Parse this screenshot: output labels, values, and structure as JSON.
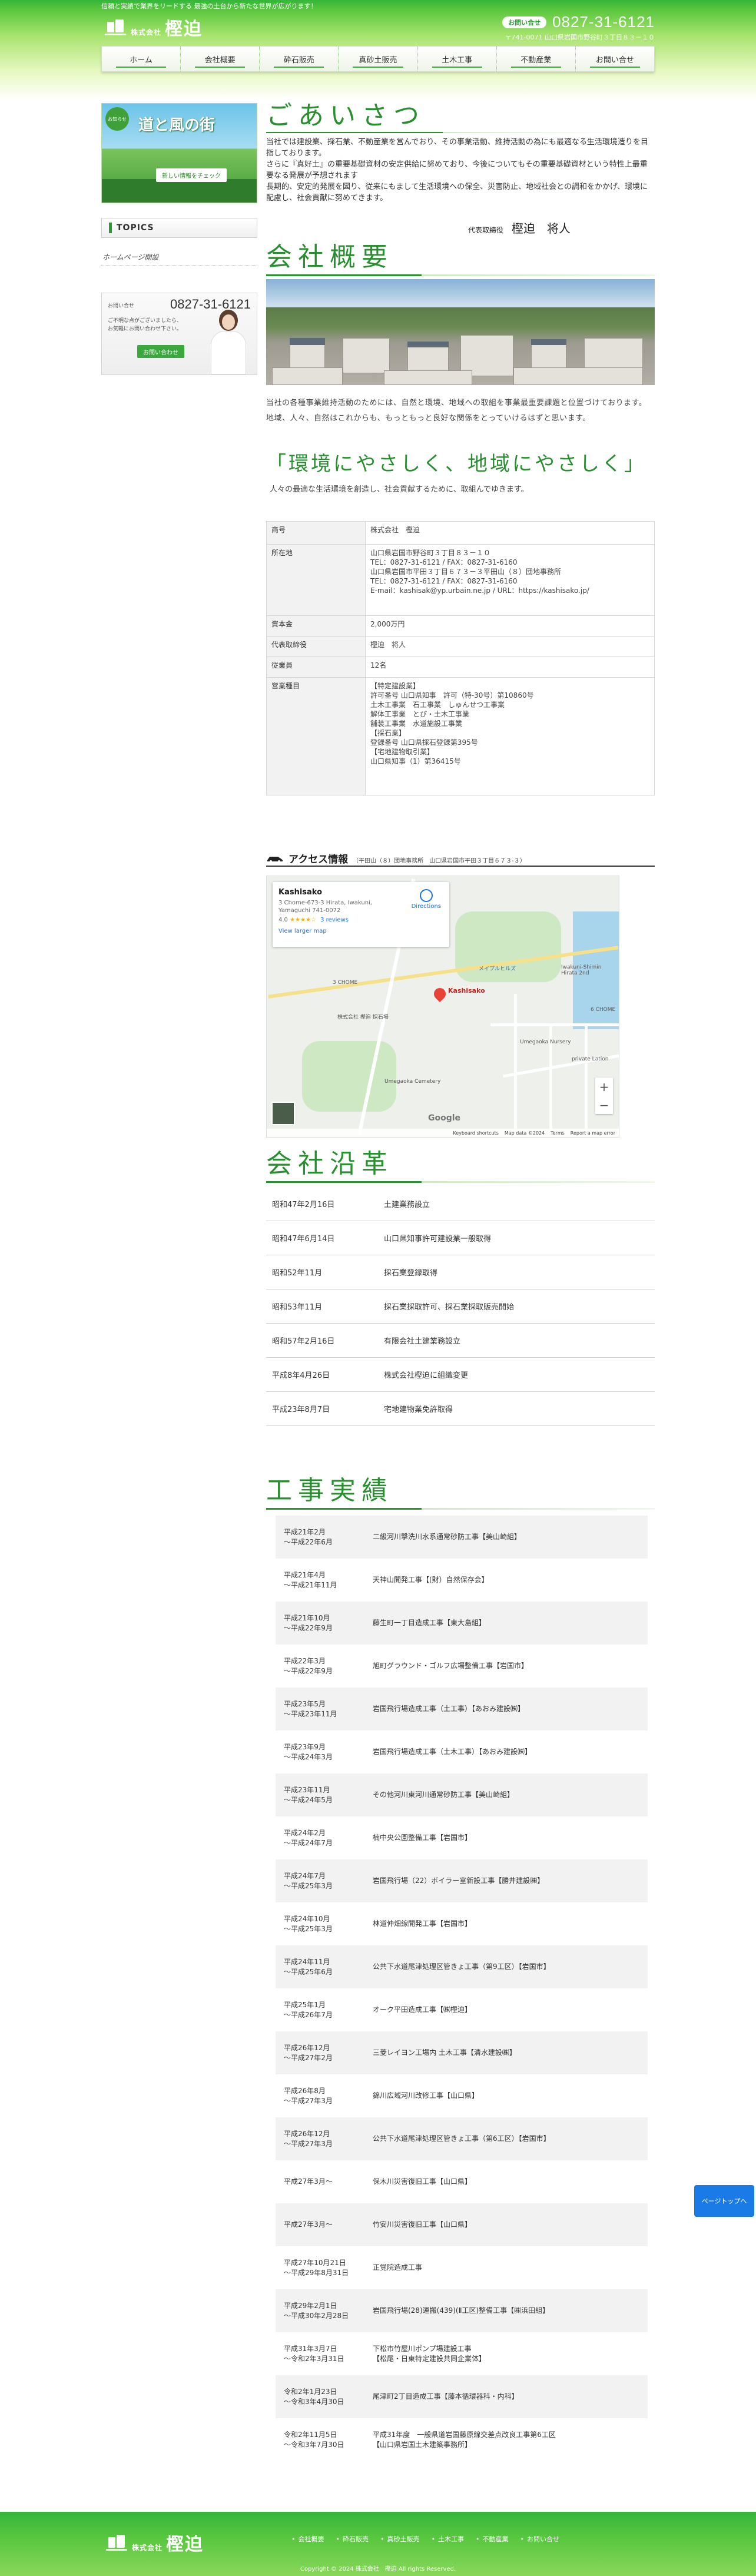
{
  "header": {
    "tagline": "信頼と実績で業界をリードする 最強の土台から新たな世界が広がります！",
    "logo_prefix": "株式会社",
    "logo_name": "樫迫",
    "contact_badge": "お問い合せ",
    "phone": "0827-31-6121",
    "address": "〒741-0071 山口県岩国市野谷町３丁目８３－１０"
  },
  "nav": [
    "ホーム",
    "会社概要",
    "砕石販売",
    "真砂土販売",
    "土木工事",
    "不動産業",
    "お問い合せ"
  ],
  "sidebar": {
    "banner_badge": "お知らせ",
    "banner_title": "道と風の街",
    "banner_sub": "新しい情報をチェック",
    "topics_label": "TOPICS",
    "topics_link": "ホームページ開設",
    "contact_label": "お問い合せ",
    "contact_phone": "0827-31-6121",
    "contact_text": "ご不明な点がございましたら、お気軽にお問い合わせ下さい。",
    "contact_button": "お問い合わせ"
  },
  "greeting": {
    "title": "ごあいさつ",
    "body": "当社では建設業、採石業、不動産業を営んでおり、その事業活動、維持活動の為にも最適なる生活環境造りを目指しております。\nさらに『真好土』の重要基礎資材の安定供給に努めており、今後についてもその重要基礎資材という特性上最重要なる発展が予想されます\n長期的、安定的発展を図り、従来にもまして生活環境への保全、災害防止、地域社会との調和をかかげ、環境に配慮し、社会貢献に努めてきます。",
    "sign_role": "代表取締役",
    "sign_name": "樫迫　将人"
  },
  "overview": {
    "title": "会社概要",
    "text": "当社の各種事業維持活動のためには、自然と環境、地域への取組を事業最重要課題と位置づけております。\n地域、人々、自然はこれからも、もっともっと良好な関係をとっていけるはずと思います。",
    "slogan": "「環境にやさしく、地域にやさしく」",
    "slogan_sub": "人々の最適な生活環境を創造し、社会貢献するために、取組んでゆきます。",
    "table": [
      {
        "k": "商号",
        "v": "株式会社　樫迫"
      },
      {
        "k": "所在地",
        "v": "山口県岩国市野谷町３丁目８３－１０\nTEL：0827-31-6121 / FAX：0827-31-6160\n山口県岩国市平田３丁目６７３－３平田山（８）団地事務所\nTEL：0827-31-6121 / FAX：0827-31-6160\nE-mail：kashisak@yp.urbain.ne.jp / URL：https://kashisako.jp/"
      },
      {
        "k": "資本金",
        "v": "2,000万円"
      },
      {
        "k": "代表取締役",
        "v": "樫迫　将人"
      },
      {
        "k": "従業員",
        "v": "12名"
      },
      {
        "k": "営業種目",
        "v": "【特定建設業】\n許可番号 山口県知事　許可（特-30号）第10860号\n土木工事業　石工事業　しゅんせつ工事業\n解体工事業　とび・土木工事業\n舗装工事業　水道施設工事業\n【採石業】\n登録番号 山口県採石登録第395号\n【宅地建物取引業】\n山口県知事（1）第36415号"
      }
    ]
  },
  "access": {
    "label": "アクセス情報",
    "addr": "（平田山（８）団地事務所　山口県岩国市平田３丁目６７３-３）",
    "map_name": "Kashisako",
    "map_addr": "3 Chome-673-3 Hirata, Iwakuni, Yamaguchi 741-0072",
    "map_rating": "4.0",
    "map_stars": "★★★★☆",
    "map_reviews": "3 reviews",
    "map_larger": "View larger map",
    "map_directions": "Directions",
    "pin_label": "Kashisako",
    "map_label_1": "メイプルヒルズ",
    "map_label_2": "Iwakuni-Shimin Hirata 2nd",
    "map_label_3": "3 CHOME",
    "map_label_4": "Umegaoka Nursery",
    "map_label_5": "Umegaoka Cemetery",
    "map_label_6": "private Lation",
    "map_label_7": "6 CHOME",
    "map_label_8": "株式会社 樫迫 採石場",
    "google": "Google",
    "map_footer": [
      "Keyboard shortcuts",
      "Map data ©2024",
      "Terms",
      "Report a map error"
    ]
  },
  "history": {
    "title": "会社沿革",
    "rows": [
      {
        "d": "昭和47年2月16日",
        "t": "土建業務設立"
      },
      {
        "d": "昭和47年6月14日",
        "t": "山口県知事許可建設業一般取得"
      },
      {
        "d": "昭和52年11月",
        "t": "採石業登録取得"
      },
      {
        "d": "昭和53年11月",
        "t": "採石業採取許可、採石業採取販売開始"
      },
      {
        "d": "昭和57年2月16日",
        "t": "有限会社土建業務設立"
      },
      {
        "d": "平成8年4月26日",
        "t": "株式会社樫迫に組織変更"
      },
      {
        "d": "平成23年8月7日",
        "t": "宅地建物業免許取得"
      }
    ]
  },
  "works": {
    "title": "工事実績",
    "rows": [
      {
        "d": "平成21年2月\n〜平成22年6月",
        "t": "二級河川撃洗川水系通常砂防工事【美山崎組】"
      },
      {
        "d": "平成21年4月\n〜平成21年11月",
        "t": "天神山開発工事【(財）自然保存会】"
      },
      {
        "d": "平成21年10月\n〜平成22年9月",
        "t": "藤生町一丁目造成工事【東大島組】"
      },
      {
        "d": "平成22年3月\n〜平成22年9月",
        "t": "旭町グラウンド・ゴルフ広場整備工事【岩国市】"
      },
      {
        "d": "平成23年5月\n〜平成23年11月",
        "t": "岩国飛行場造成工事（土工事）【あおみ建設㈱】"
      },
      {
        "d": "平成23年9月\n〜平成24年3月",
        "t": "岩国飛行場造成工事（土木工事）【あおみ建設㈱】"
      },
      {
        "d": "平成23年11月\n〜平成24年5月",
        "t": "その他河川東河川通常砂防工事【美山崎組】"
      },
      {
        "d": "平成24年2月\n〜平成24年7月",
        "t": "楠中央公園整備工事【岩国市】"
      },
      {
        "d": "平成24年7月\n〜平成25年3月",
        "t": "岩国飛行場（22）ボイラー室新設工事【勝井建設㈱】"
      },
      {
        "d": "平成24年10月\n〜平成25年3月",
        "t": "林道仲畑線開発工事【岩国市】"
      },
      {
        "d": "平成24年11月\n〜平成25年6月",
        "t": "公共下水道尾津処理区管きょ工事（第9工区）【岩国市】"
      },
      {
        "d": "平成25年1月\n〜平成26年7月",
        "t": "オーク平田造成工事【㈱樫迫】"
      },
      {
        "d": "平成26年12月\n〜平成27年2月",
        "t": "三菱レイヨン工場内 土木工事【清水建設㈱】"
      },
      {
        "d": "平成26年8月\n〜平成27年3月",
        "t": "錦川広域河川改修工事【山口県】"
      },
      {
        "d": "平成26年12月\n〜平成27年3月",
        "t": "公共下水道尾津処理区管きょ工事（第6工区）【岩国市】"
      },
      {
        "d": "平成27年3月〜",
        "t": "保木川災害復旧工事【山口県】"
      },
      {
        "d": "平成27年3月〜",
        "t": "竹安川災害復旧工事【山口県】"
      },
      {
        "d": "平成27年10月21日\n〜平成29年8月31日",
        "t": "正覚院造成工事"
      },
      {
        "d": "平成29年2月1日\n〜平成30年2月28日",
        "t": "岩国飛行場(28)運搬(439)(Ⅱ工区)整備工事【㈱浜田組】"
      },
      {
        "d": "平成31年3月7日\n〜令和2年3月31日",
        "t": "下松市竹屋川ポンプ場建設工事\n【松尾・日東特定建設共同企業体】"
      },
      {
        "d": "令和2年1月23日\n〜令和3年4月30日",
        "t": "尾津町2丁目造成工事【藤本循環器科・内科】"
      },
      {
        "d": "令和2年11月5日\n〜令和3年7月30日",
        "t": "平成31年度　一般県道岩国藤原線交差点改良工事第6工区\n【山口県岩国土木建築事務所】"
      }
    ]
  },
  "pagetop": "ページトップへ",
  "footer": {
    "logo_prefix": "株式会社",
    "logo_name": "樫迫",
    "nav": [
      "会社概要",
      "砕石販売",
      "真砂土販売",
      "土木工事",
      "不動産業",
      "お問い合せ"
    ],
    "copyright": "Copyright © 2024 株式会社　樫迫 All rights Reserved."
  },
  "colors": {
    "brand_green": "#2a8f30",
    "header_green": "#34b53a",
    "pagetop_blue": "#1a7ae6"
  }
}
